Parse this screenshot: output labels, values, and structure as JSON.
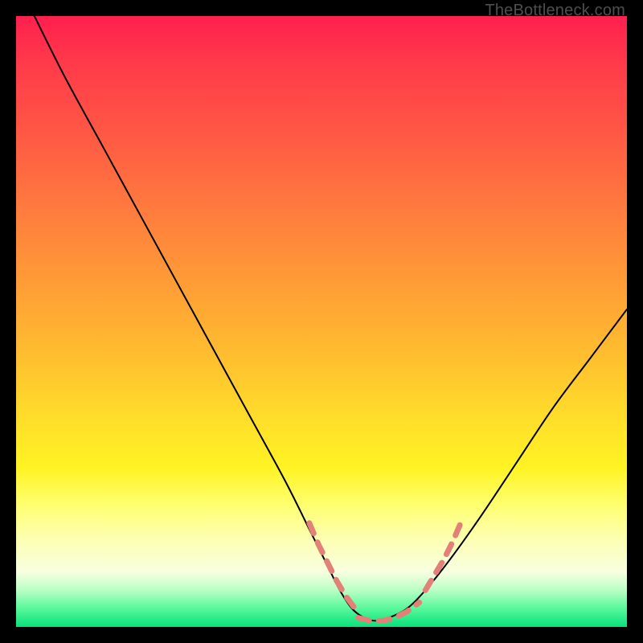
{
  "watermark": "TheBottleneck.com",
  "chart_data": {
    "type": "line",
    "title": "",
    "xlabel": "",
    "ylabel": "",
    "xlim": [
      0,
      100
    ],
    "ylim": [
      0,
      100
    ],
    "grid": false,
    "legend": false,
    "annotations": [],
    "series": [
      {
        "name": "curve",
        "stroke": "#000000",
        "stroke_width": 2,
        "x": [
          3,
          8,
          14,
          20,
          26,
          32,
          38,
          44,
          48,
          51,
          53,
          55,
          57,
          59,
          61,
          64,
          67,
          71,
          76,
          82,
          88,
          94,
          100
        ],
        "y": [
          100,
          90,
          79,
          68,
          57,
          46,
          35,
          24,
          16,
          10,
          6,
          3,
          1.5,
          1,
          1.5,
          3,
          6,
          11,
          18,
          27,
          36,
          44,
          52
        ]
      },
      {
        "name": "dotted-left",
        "stroke": "#e38078",
        "stroke_width": 7,
        "style": "dashed",
        "x": [
          48,
          49.5,
          51,
          52.5,
          54,
          55.5
        ],
        "y": [
          17,
          13.5,
          10.5,
          7.5,
          5,
          3
        ]
      },
      {
        "name": "dotted-bottom",
        "stroke": "#e38078",
        "stroke_width": 7,
        "style": "dashed",
        "x": [
          56,
          58,
          60,
          62,
          64,
          66
        ],
        "y": [
          1.5,
          1,
          1,
          1.5,
          2.5,
          4
        ]
      },
      {
        "name": "dotted-right",
        "stroke": "#e38078",
        "stroke_width": 7,
        "style": "dashed",
        "x": [
          67,
          68.5,
          70,
          71.5,
          73
        ],
        "y": [
          6,
          8.5,
          11,
          14,
          17.5
        ]
      }
    ],
    "gradient_stops": [
      {
        "offset": 0,
        "color": "#ff1f4e"
      },
      {
        "offset": 8,
        "color": "#ff3b4a"
      },
      {
        "offset": 20,
        "color": "#ff5a44"
      },
      {
        "offset": 32,
        "color": "#ff7c3e"
      },
      {
        "offset": 44,
        "color": "#ff9d36"
      },
      {
        "offset": 56,
        "color": "#ffbf2f"
      },
      {
        "offset": 66,
        "color": "#ffde2a"
      },
      {
        "offset": 74,
        "color": "#fff324"
      },
      {
        "offset": 80,
        "color": "#feff6f"
      },
      {
        "offset": 86,
        "color": "#fdffb5"
      },
      {
        "offset": 91,
        "color": "#f7ffe0"
      },
      {
        "offset": 94,
        "color": "#b9ffc6"
      },
      {
        "offset": 97,
        "color": "#57f79a"
      },
      {
        "offset": 100,
        "color": "#07e27c"
      }
    ]
  }
}
